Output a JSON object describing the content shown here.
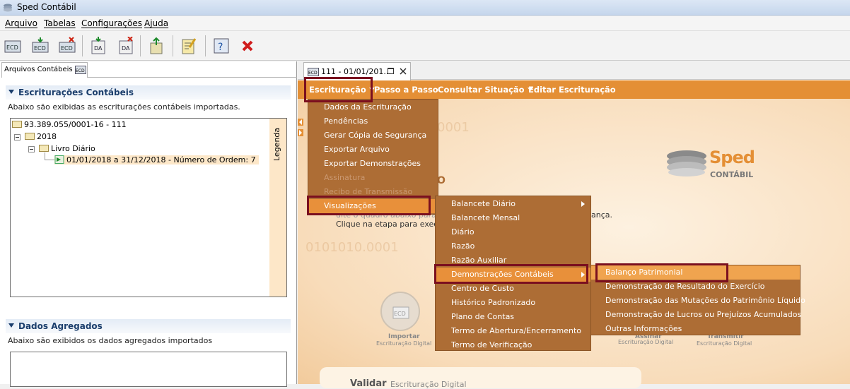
{
  "window": {
    "title": "Sped Contábil"
  },
  "menubar": {
    "items": [
      "Arquivo",
      "Tabelas",
      "Configurações",
      "Ajuda"
    ]
  },
  "left_panel": {
    "tab_label": "Arquivos Contábeis",
    "section1": {
      "title": "Escriturações Contábeis",
      "description": "Abaixo são exibidas as escriturações contábeis importadas.",
      "tree": {
        "company": "93.389.055/0001-16 - 111",
        "year": "2018",
        "book": "Livro Diário",
        "entry": "01/01/2018 a 31/12/2018 - Número de Ordem: 7"
      },
      "legend": "Legenda"
    },
    "section2": {
      "title": "Dados Agregados",
      "description": "Abaixo são exibidos os dados agregados importados"
    }
  },
  "doc_tab": {
    "label": "111 - 01/01/201..."
  },
  "orange_bar": {
    "escrituracao": "Escrituração",
    "passo": "Passo a Passo",
    "consultar": "Consultar Situação",
    "editar": "Editar Escrituração"
  },
  "menu_escrituracao": {
    "items": [
      "Dados da Escrituração",
      "Pendências",
      "Gerar Cópia de Segurança",
      "Exportar Arquivo",
      "Exportar Demonstrações",
      "Assinatura",
      "Recibo de Transmissão",
      "Visualizações"
    ]
  },
  "menu_visualizacoes": {
    "items": [
      "Balancete Diário",
      "Balancete Mensal",
      "Diário",
      "Razão",
      "Razão Auxiliar",
      "Demonstrações Contábeis",
      "Centro de Custo",
      "Histórico Padronizado",
      "Plano de Contas",
      "Termo de Abertura/Encerramento",
      "Termo de Verificação"
    ]
  },
  "menu_demonstracoes": {
    "items": [
      "Balanço Patrimonial",
      "Demonstração de Resultado do Exercício",
      "Demonstração das Mutações do Patrimônio Líquido",
      "Demonstração de Lucros ou Prejuízos Acumulados",
      "Outras Informações"
    ]
  },
  "background": {
    "logo_sped": "Sped",
    "logo_contabil": "CONTÁBIL",
    "text_line1": "uite o quadro abaixo para",
    "text_line1b": "ança.",
    "text_line2": "Clique na etapa para exec",
    "faint_num1": "0001",
    "faint_num2": "0101010.0001",
    "step1_title": "Importar",
    "step1_sub": "Escrituração Digital",
    "step4_title": "Assinar",
    "step4_sub": "Escrituração Digital",
    "step5_title": "Transmitir",
    "step5_sub": "Escrituração Digital",
    "validar": "Validar",
    "validar_sub": "Escrituração Digital"
  },
  "colors": {
    "orange": "#e48f35",
    "menu_bg": "#ad6d35",
    "highlight_box": "#7a0f1f"
  }
}
